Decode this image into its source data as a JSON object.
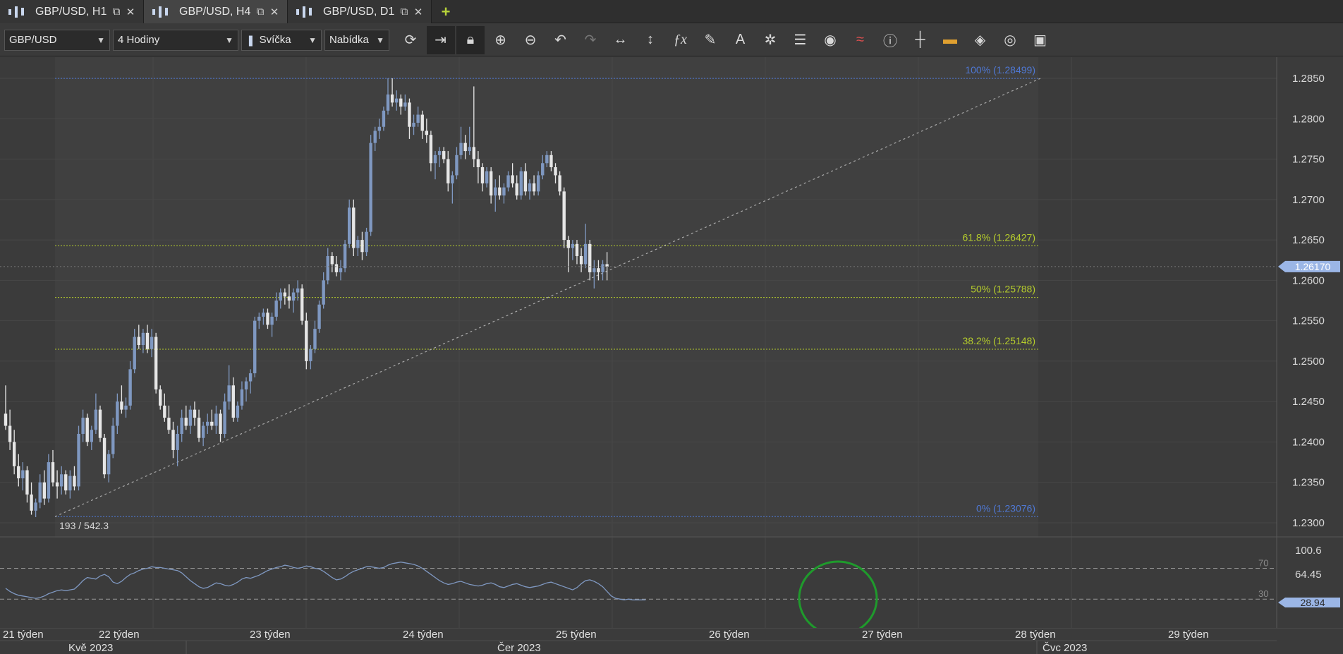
{
  "tabs": [
    {
      "label": "GBP/USD, H1",
      "active": false
    },
    {
      "label": "GBP/USD, H4",
      "active": true
    },
    {
      "label": "GBP/USD, D1",
      "active": false
    }
  ],
  "toolbar": {
    "symbol": "GBP/USD",
    "timeframe": "4 Hodiny",
    "chart_type": "Svíčka",
    "price_type": "Nabídka",
    "tools": [
      "refresh-icon",
      "autoscroll-icon",
      "lock-icon",
      "zoom-in-icon",
      "zoom-out-icon",
      "undo-icon",
      "redo-icon",
      "fit-horizontal-icon",
      "fit-vertical-icon",
      "indicators-fx-icon",
      "pencil-icon",
      "text-tool-icon",
      "pattern-icon",
      "layers-icon",
      "eye-icon",
      "signal-icon",
      "info-icon",
      "crosshair-icon",
      "color-strip-icon",
      "fill-bucket-icon",
      "template-icon",
      "save-icon"
    ]
  },
  "colors": {
    "background": "#3b3b3b",
    "grid": "#474747",
    "up_candle": "#7f98c1",
    "down_candle": "#e6e6e6",
    "fib_main": "#4f78d4",
    "fib_mid": "#b5cc2c",
    "current_price": "#9bb6e6",
    "rsi_line": "#7f98c1",
    "annotation_circle": "#1f9a2c"
  },
  "chart_data": [
    {
      "type": "candlestick",
      "symbol": "GBP/USD",
      "y_ticks": [
        "1.2850",
        "1.2800",
        "1.2750",
        "1.2700",
        "1.2650",
        "1.2600",
        "1.2550",
        "1.2500",
        "1.2450",
        "1.2400",
        "1.2350",
        "1.2300"
      ],
      "ylim": [
        1.228,
        1.2875
      ],
      "current_price": "1.26170",
      "fibonacci": [
        {
          "label": "100% (1.28499)",
          "value": 1.28499,
          "level": "100"
        },
        {
          "label": "61.8% (1.26427)",
          "value": 1.26427,
          "level": "61.8"
        },
        {
          "label": "50% (1.25788)",
          "value": 1.25788,
          "level": "50"
        },
        {
          "label": "38.2% (1.25148)",
          "value": 1.25148,
          "level": "38.2"
        },
        {
          "label": "0% (1.23076)",
          "value": 1.23076,
          "level": "0"
        }
      ],
      "trendline": {
        "from": 1.23076,
        "to": 1.28499
      },
      "annotation": "193 / 542.3",
      "candles": [
        [
          1.2435,
          1.247,
          1.2415,
          1.242
        ],
        [
          1.242,
          1.244,
          1.239,
          1.24
        ],
        [
          1.24,
          1.2415,
          1.236,
          1.237
        ],
        [
          1.237,
          1.2385,
          1.2345,
          1.2355
        ],
        [
          1.2355,
          1.2375,
          1.234,
          1.2365
        ],
        [
          1.2365,
          1.237,
          1.2325,
          1.2335
        ],
        [
          1.2335,
          1.235,
          1.231,
          1.2315
        ],
        [
          1.2315,
          1.233,
          1.2307,
          1.2325
        ],
        [
          1.2325,
          1.236,
          1.2318,
          1.235
        ],
        [
          1.235,
          1.2365,
          1.2322,
          1.233
        ],
        [
          1.233,
          1.2385,
          1.2325,
          1.2375
        ],
        [
          1.2375,
          1.239,
          1.2345,
          1.235
        ],
        [
          1.235,
          1.2365,
          1.233,
          1.2345
        ],
        [
          1.2345,
          1.237,
          1.2335,
          1.236
        ],
        [
          1.236,
          1.2365,
          1.2335,
          1.234
        ],
        [
          1.234,
          1.2365,
          1.233,
          1.2358
        ],
        [
          1.2358,
          1.237,
          1.234,
          1.2345
        ],
        [
          1.2345,
          1.242,
          1.234,
          1.241
        ],
        [
          1.241,
          1.244,
          1.24,
          1.243
        ],
        [
          1.243,
          1.2435,
          1.2395,
          1.24
        ],
        [
          1.24,
          1.242,
          1.239,
          1.2415
        ],
        [
          1.2415,
          1.246,
          1.241,
          1.244
        ],
        [
          1.244,
          1.2445,
          1.24,
          1.2405
        ],
        [
          1.2405,
          1.241,
          1.2355,
          1.236
        ],
        [
          1.236,
          1.239,
          1.235,
          1.2385
        ],
        [
          1.2385,
          1.243,
          1.238,
          1.242
        ],
        [
          1.242,
          1.246,
          1.241,
          1.245
        ],
        [
          1.245,
          1.247,
          1.2435,
          1.244
        ],
        [
          1.244,
          1.2455,
          1.243,
          1.2445
        ],
        [
          1.2445,
          1.25,
          1.244,
          1.249
        ],
        [
          1.249,
          1.254,
          1.2485,
          1.253
        ],
        [
          1.253,
          1.2545,
          1.2515,
          1.252
        ],
        [
          1.252,
          1.254,
          1.251,
          1.2535
        ],
        [
          1.2535,
          1.2545,
          1.251,
          1.2515
        ],
        [
          1.2515,
          1.254,
          1.2505,
          1.253
        ],
        [
          1.253,
          1.2535,
          1.246,
          1.2465
        ],
        [
          1.2465,
          1.247,
          1.244,
          1.2445
        ],
        [
          1.2445,
          1.246,
          1.2425,
          1.243
        ],
        [
          1.243,
          1.2445,
          1.241,
          1.2415
        ],
        [
          1.2415,
          1.2425,
          1.238,
          1.239
        ],
        [
          1.239,
          1.242,
          1.237,
          1.241
        ],
        [
          1.241,
          1.244,
          1.24,
          1.243
        ],
        [
          1.243,
          1.2445,
          1.2415,
          1.242
        ],
        [
          1.242,
          1.2445,
          1.241,
          1.244
        ],
        [
          1.244,
          1.245,
          1.242,
          1.243
        ],
        [
          1.243,
          1.244,
          1.24,
          1.2405
        ],
        [
          1.2405,
          1.2425,
          1.2395,
          1.242
        ],
        [
          1.242,
          1.2435,
          1.241,
          1.2425
        ],
        [
          1.2425,
          1.244,
          1.2415,
          1.242
        ],
        [
          1.242,
          1.2445,
          1.241,
          1.2435
        ],
        [
          1.2435,
          1.244,
          1.24,
          1.241
        ],
        [
          1.241,
          1.246,
          1.2405,
          1.245
        ],
        [
          1.245,
          1.2495,
          1.244,
          1.247
        ],
        [
          1.247,
          1.248,
          1.2425,
          1.243
        ],
        [
          1.243,
          1.245,
          1.2425,
          1.2445
        ],
        [
          1.2445,
          1.2475,
          1.244,
          1.2465
        ],
        [
          1.2465,
          1.248,
          1.245,
          1.2475
        ],
        [
          1.2475,
          1.249,
          1.246,
          1.2485
        ],
        [
          1.2485,
          1.2555,
          1.248,
          1.255
        ],
        [
          1.255,
          1.256,
          1.254,
          1.2555
        ],
        [
          1.2555,
          1.2565,
          1.2545,
          1.256
        ],
        [
          1.256,
          1.2565,
          1.254,
          1.2545
        ],
        [
          1.2545,
          1.256,
          1.253,
          1.2555
        ],
        [
          1.2555,
          1.2585,
          1.255,
          1.2575
        ],
        [
          1.2575,
          1.259,
          1.2565,
          1.2585
        ],
        [
          1.2585,
          1.259,
          1.257,
          1.258
        ],
        [
          1.258,
          1.2595,
          1.2565,
          1.2575
        ],
        [
          1.2575,
          1.259,
          1.256,
          1.2585
        ],
        [
          1.2585,
          1.26,
          1.2575,
          1.259
        ],
        [
          1.259,
          1.2595,
          1.2545,
          1.255
        ],
        [
          1.255,
          1.256,
          1.249,
          1.25
        ],
        [
          1.25,
          1.252,
          1.249,
          1.2515
        ],
        [
          1.2515,
          1.255,
          1.251,
          1.254
        ],
        [
          1.254,
          1.2575,
          1.2535,
          1.257
        ],
        [
          1.257,
          1.261,
          1.2565,
          1.26
        ],
        [
          1.26,
          1.264,
          1.2595,
          1.263
        ],
        [
          1.263,
          1.2635,
          1.261,
          1.262
        ],
        [
          1.262,
          1.263,
          1.2605,
          1.261
        ],
        [
          1.261,
          1.2625,
          1.26,
          1.2615
        ],
        [
          1.2615,
          1.265,
          1.261,
          1.2645
        ],
        [
          1.2645,
          1.27,
          1.264,
          1.269
        ],
        [
          1.269,
          1.27,
          1.263,
          1.264
        ],
        [
          1.264,
          1.2655,
          1.263,
          1.265
        ],
        [
          1.265,
          1.266,
          1.2625,
          1.2635
        ],
        [
          1.2635,
          1.2665,
          1.263,
          1.266
        ],
        [
          1.266,
          1.278,
          1.2655,
          1.277
        ],
        [
          1.277,
          1.279,
          1.276,
          1.2785
        ],
        [
          1.2785,
          1.28,
          1.2775,
          1.279
        ],
        [
          1.279,
          1.2815,
          1.2785,
          1.281
        ],
        [
          1.281,
          1.285,
          1.2805,
          1.283
        ],
        [
          1.283,
          1.285,
          1.2815,
          1.282
        ],
        [
          1.282,
          1.2835,
          1.281,
          1.2825
        ],
        [
          1.2825,
          1.283,
          1.2805,
          1.2815
        ],
        [
          1.2815,
          1.283,
          1.281,
          1.282
        ],
        [
          1.282,
          1.2825,
          1.2775,
          1.279
        ],
        [
          1.279,
          1.2805,
          1.278,
          1.2795
        ],
        [
          1.2795,
          1.2815,
          1.279,
          1.2805
        ],
        [
          1.2805,
          1.281,
          1.2775,
          1.2785
        ],
        [
          1.2785,
          1.28,
          1.277,
          1.278
        ],
        [
          1.278,
          1.2785,
          1.2735,
          1.2745
        ],
        [
          1.2745,
          1.276,
          1.2725,
          1.2755
        ],
        [
          1.2755,
          1.2765,
          1.274,
          1.276
        ],
        [
          1.276,
          1.2765,
          1.2745,
          1.275
        ],
        [
          1.275,
          1.276,
          1.271,
          1.272
        ],
        [
          1.272,
          1.2735,
          1.2695,
          1.273
        ],
        [
          1.273,
          1.2765,
          1.2725,
          1.2755
        ],
        [
          1.2755,
          1.279,
          1.275,
          1.277
        ],
        [
          1.277,
          1.278,
          1.275,
          1.276
        ],
        [
          1.276,
          1.279,
          1.2755,
          1.2765
        ],
        [
          1.2765,
          1.284,
          1.274,
          1.275
        ],
        [
          1.275,
          1.276,
          1.272,
          1.274
        ],
        [
          1.274,
          1.2745,
          1.271,
          1.272
        ],
        [
          1.272,
          1.274,
          1.2715,
          1.2735
        ],
        [
          1.2735,
          1.274,
          1.2695,
          1.2705
        ],
        [
          1.2705,
          1.2725,
          1.2685,
          1.2715
        ],
        [
          1.2715,
          1.273,
          1.27,
          1.2705
        ],
        [
          1.2705,
          1.272,
          1.2695,
          1.2715
        ],
        [
          1.2715,
          1.2735,
          1.271,
          1.273
        ],
        [
          1.273,
          1.2745,
          1.2715,
          1.272
        ],
        [
          1.272,
          1.273,
          1.27,
          1.2705
        ],
        [
          1.2705,
          1.274,
          1.27,
          1.2735
        ],
        [
          1.2735,
          1.2745,
          1.2705,
          1.271
        ],
        [
          1.271,
          1.2725,
          1.27,
          1.272
        ],
        [
          1.272,
          1.273,
          1.2705,
          1.271
        ],
        [
          1.271,
          1.2735,
          1.2705,
          1.273
        ],
        [
          1.273,
          1.2755,
          1.2725,
          1.2745
        ],
        [
          1.2745,
          1.276,
          1.274,
          1.2755
        ],
        [
          1.2755,
          1.276,
          1.2735,
          1.274
        ],
        [
          1.274,
          1.2745,
          1.272,
          1.273
        ],
        [
          1.273,
          1.2735,
          1.2705,
          1.271
        ],
        [
          1.271,
          1.2715,
          1.264,
          1.265
        ],
        [
          1.265,
          1.2655,
          1.261,
          1.264
        ],
        [
          1.264,
          1.265,
          1.2625,
          1.2645
        ],
        [
          1.2645,
          1.265,
          1.262,
          1.263
        ],
        [
          1.263,
          1.264,
          1.261,
          1.262
        ],
        [
          1.262,
          1.267,
          1.2615,
          1.2645
        ],
        [
          1.2645,
          1.265,
          1.26,
          1.261
        ],
        [
          1.261,
          1.2625,
          1.259,
          1.2615
        ],
        [
          1.2615,
          1.2625,
          1.26,
          1.261
        ],
        [
          1.261,
          1.2625,
          1.26,
          1.262
        ],
        [
          1.262,
          1.2635,
          1.26,
          1.2617
        ]
      ]
    },
    {
      "type": "line",
      "name": "RSI",
      "y_ticks": [
        "100.6",
        "64.45",
        "30",
        "70"
      ],
      "ylim": [
        0,
        100.6
      ],
      "levels": [
        70,
        30
      ],
      "current_value": "28.94",
      "values": [
        44,
        40,
        37,
        35,
        34,
        33,
        32,
        31,
        32,
        34,
        37,
        39,
        41,
        42,
        41,
        42,
        43,
        48,
        54,
        58,
        57,
        56,
        60,
        62,
        59,
        52,
        50,
        53,
        58,
        62,
        64,
        67,
        69,
        70,
        72,
        71,
        71,
        70,
        69,
        68,
        67,
        64,
        59,
        54,
        50,
        46,
        44,
        45,
        48,
        51,
        50,
        48,
        47,
        49,
        52,
        56,
        58,
        57,
        59,
        61,
        64,
        67,
        69,
        71,
        72,
        74,
        73,
        71,
        70,
        71,
        73,
        72,
        70,
        69,
        66,
        62,
        58,
        55,
        56,
        59,
        63,
        66,
        68,
        70,
        72,
        72,
        71,
        70,
        71,
        74,
        76,
        77,
        78,
        77,
        76,
        75,
        73,
        70,
        66,
        62,
        58,
        54,
        51,
        49,
        50,
        52,
        53,
        51,
        49,
        48,
        47,
        48,
        50,
        51,
        49,
        46,
        45,
        47,
        49,
        50,
        48,
        46,
        45,
        46,
        47,
        49,
        51,
        52,
        50,
        48,
        46,
        44,
        42,
        45,
        50,
        54,
        55,
        53,
        50,
        46,
        40,
        34,
        31,
        30,
        29,
        30,
        29,
        29,
        29,
        29
      ]
    }
  ],
  "time_axis": {
    "weeks": [
      "21 týden",
      "22 týden",
      "23 týden",
      "24 týden",
      "25 týden",
      "26 týden",
      "27 týden",
      "28 týden",
      "29 týden"
    ],
    "months": [
      "Kvě 2023",
      "Čer 2023",
      "Čvc 2023"
    ]
  }
}
